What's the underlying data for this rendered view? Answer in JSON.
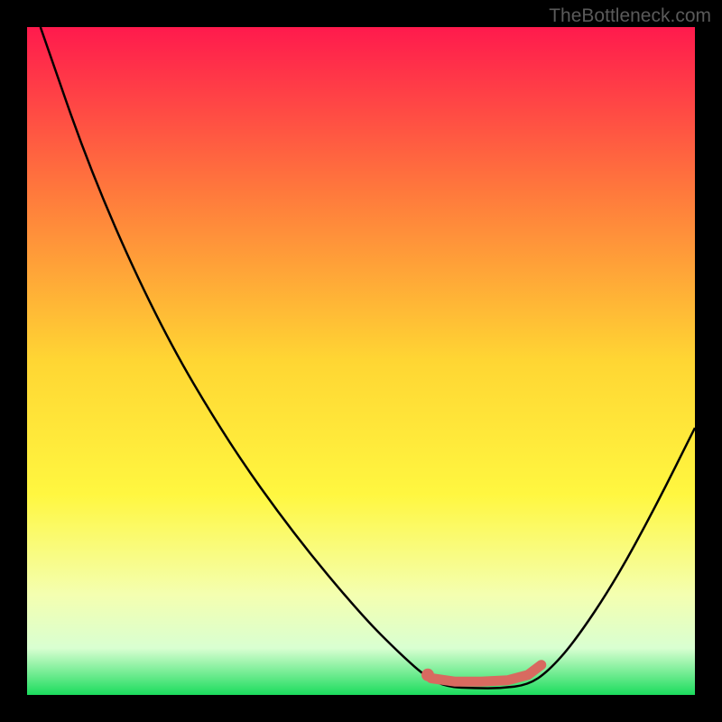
{
  "watermark": "TheBottleneck.com",
  "chart_data": {
    "type": "line",
    "title": "",
    "xlabel": "",
    "ylabel": "",
    "xlim": [
      0,
      100
    ],
    "ylim": [
      0,
      100
    ],
    "background_gradient": {
      "stops": [
        {
          "offset": 0,
          "color": "#ff1a4d"
        },
        {
          "offset": 25,
          "color": "#ff7a3c"
        },
        {
          "offset": 50,
          "color": "#ffd633"
        },
        {
          "offset": 70,
          "color": "#fff740"
        },
        {
          "offset": 85,
          "color": "#f4ffb0"
        },
        {
          "offset": 93,
          "color": "#d9ffd1"
        },
        {
          "offset": 100,
          "color": "#1bdc5d"
        }
      ]
    },
    "series": [
      {
        "name": "bottleneck-curve",
        "color": "#000000",
        "points": [
          {
            "x": 2,
            "y": 100
          },
          {
            "x": 10,
            "y": 77
          },
          {
            "x": 20,
            "y": 55
          },
          {
            "x": 30,
            "y": 38
          },
          {
            "x": 40,
            "y": 24
          },
          {
            "x": 50,
            "y": 12
          },
          {
            "x": 56,
            "y": 6
          },
          {
            "x": 60,
            "y": 2.5
          },
          {
            "x": 63,
            "y": 1.2
          },
          {
            "x": 67,
            "y": 1.0
          },
          {
            "x": 71,
            "y": 1.0
          },
          {
            "x": 75,
            "y": 1.5
          },
          {
            "x": 78,
            "y": 3.5
          },
          {
            "x": 82,
            "y": 8
          },
          {
            "x": 88,
            "y": 17
          },
          {
            "x": 94,
            "y": 28
          },
          {
            "x": 100,
            "y": 40
          }
        ]
      }
    ],
    "highlight": {
      "color": "#d86a60",
      "dot": {
        "x": 60,
        "y": 3
      },
      "segment": [
        {
          "x": 60.5,
          "y": 2.5
        },
        {
          "x": 64,
          "y": 2.0
        },
        {
          "x": 68,
          "y": 2.0
        },
        {
          "x": 72,
          "y": 2.2
        },
        {
          "x": 75,
          "y": 3.0
        },
        {
          "x": 77,
          "y": 4.5
        }
      ]
    }
  }
}
